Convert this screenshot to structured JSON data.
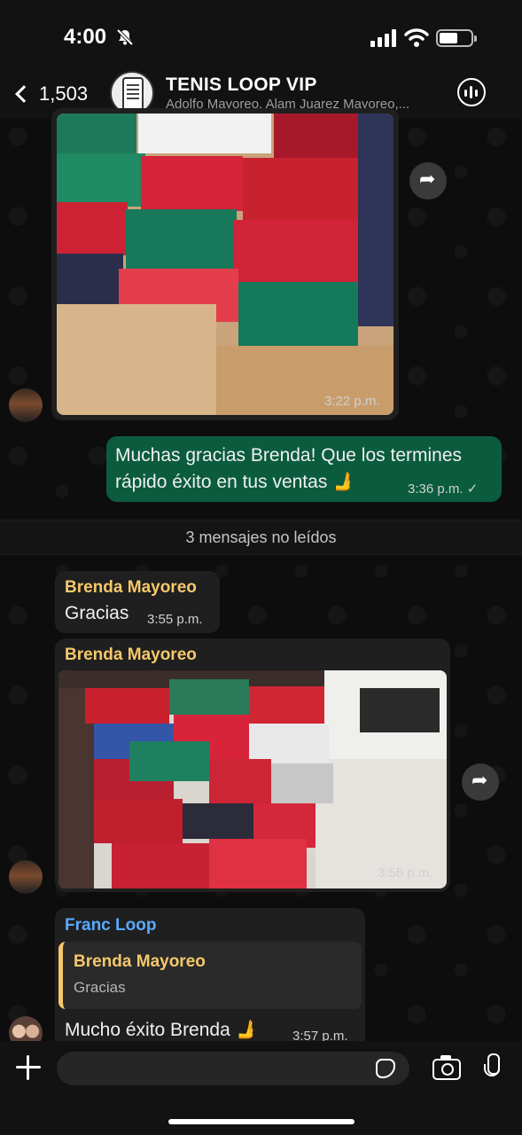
{
  "status_bar": {
    "time": "4:00"
  },
  "header": {
    "back_count": "1,503",
    "group_name": "TENIS LOOP VIP",
    "members": "Adolfo Mayoreo, Alam Juarez Mayoreo,..."
  },
  "messages": [
    {
      "kind": "image",
      "direction": "incoming",
      "time": "3:22 p.m."
    },
    {
      "kind": "text",
      "direction": "outgoing",
      "text_line1": "Muchas gracias Brenda! Que los termines",
      "text_line2": "rápido éxito en tus ventas 🫸",
      "time": "3:36 p.m. ✓"
    },
    {
      "kind": "text",
      "direction": "incoming",
      "sender": "Brenda Mayoreo",
      "text": "Gracias",
      "time": "3:55 p.m."
    },
    {
      "kind": "image",
      "direction": "incoming",
      "sender": "Brenda Mayoreo",
      "time": "3:55 p.m."
    },
    {
      "kind": "reply",
      "direction": "incoming",
      "sender": "Franc Loop",
      "quoted_sender": "Brenda Mayoreo",
      "quoted_text": "Gracias",
      "text": "Mucho éxito Brenda 🫸",
      "time": "3:57 p.m."
    }
  ],
  "unread_divider": "3 mensajes no leídos",
  "composer": {
    "placeholder": ""
  },
  "colors": {
    "sender_brenda": "#f5c86b",
    "sender_franc": "#5aa9ff",
    "outgoing_bubble": "#0b5c3e",
    "incoming_bubble": "#1f1f1f"
  }
}
